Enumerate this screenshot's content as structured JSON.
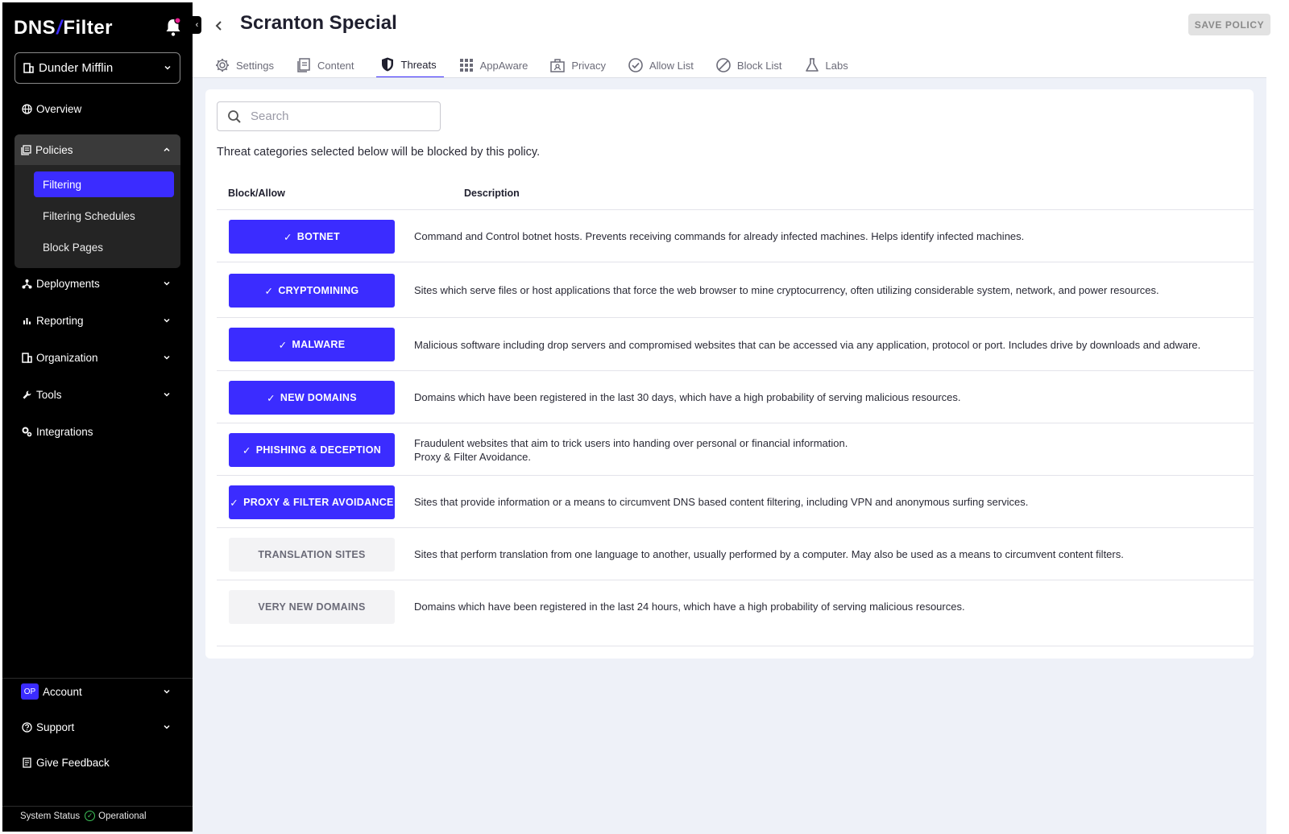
{
  "brand": {
    "left": "DNS",
    "right": "Filter"
  },
  "org_select": {
    "value": "Dunder Mifflin"
  },
  "nav": {
    "overview": "Overview",
    "policies": "Policies",
    "policies_sub": [
      "Filtering",
      "Filtering Schedules",
      "Block Pages"
    ],
    "deployments": "Deployments",
    "reporting": "Reporting",
    "organization": "Organization",
    "tools": "Tools",
    "integrations": "Integrations",
    "account_badge": "OP",
    "account": "Account",
    "support": "Support",
    "feedback": "Give Feedback"
  },
  "status": {
    "label": "System Status",
    "value": "Operational"
  },
  "header": {
    "title": "Scranton Special",
    "save_label": "SAVE POLICY"
  },
  "tabs": [
    {
      "label": "Settings",
      "icon": "gear-icon"
    },
    {
      "label": "Content",
      "icon": "document-icon"
    },
    {
      "label": "Threats",
      "icon": "shield-icon"
    },
    {
      "label": "AppAware",
      "icon": "grid-icon"
    },
    {
      "label": "Privacy",
      "icon": "privacy-icon"
    },
    {
      "label": "Allow List",
      "icon": "check-circle-icon"
    },
    {
      "label": "Block List",
      "icon": "block-icon"
    },
    {
      "label": "Labs",
      "icon": "flask-icon"
    }
  ],
  "search": {
    "placeholder": "Search"
  },
  "intro": "Threat categories selected below will be blocked by this policy.",
  "columns": {
    "block_allow": "Block/Allow",
    "description": "Description"
  },
  "categories": [
    {
      "label": "BOTNET",
      "blocked": true,
      "description": "Command and Control botnet hosts. Prevents receiving commands for already infected machines. Helps identify infected machines."
    },
    {
      "label": "CRYPTOMINING",
      "blocked": true,
      "description": "Sites which serve files or host applications that force the web browser to mine cryptocurrency, often utilizing considerable system, network, and power resources."
    },
    {
      "label": "MALWARE",
      "blocked": true,
      "description": "Malicious software including drop servers and compromised websites that can be accessed via any application, protocol or port. Includes drive by downloads and adware."
    },
    {
      "label": "NEW DOMAINS",
      "blocked": true,
      "description": "Domains which have been registered in the last 30 days, which have a high probability of serving malicious resources."
    },
    {
      "label": "PHISHING & DECEPTION",
      "blocked": true,
      "description": "Fraudulent websites that aim to trick users into handing over personal or financial information.\nProxy & Filter Avoidance."
    },
    {
      "label": "PROXY & FILTER AVOIDANCE",
      "blocked": true,
      "description": "Sites that provide information or a means to circumvent DNS based content filtering, including VPN and anonymous surfing services."
    },
    {
      "label": "TRANSLATION SITES",
      "blocked": false,
      "description": "Sites that perform translation from one language to another, usually performed by a computer. May also be used as a means to circumvent content filters."
    },
    {
      "label": "VERY NEW DOMAINS",
      "blocked": false,
      "description": "Domains which have been registered in the last 24 hours, which have a high probability of serving malicious resources."
    }
  ],
  "colors": {
    "accent": "#3b2cff",
    "sidebar": "#000000",
    "content_bg": "#eef1f8",
    "status_ok": "#3ec55a"
  }
}
